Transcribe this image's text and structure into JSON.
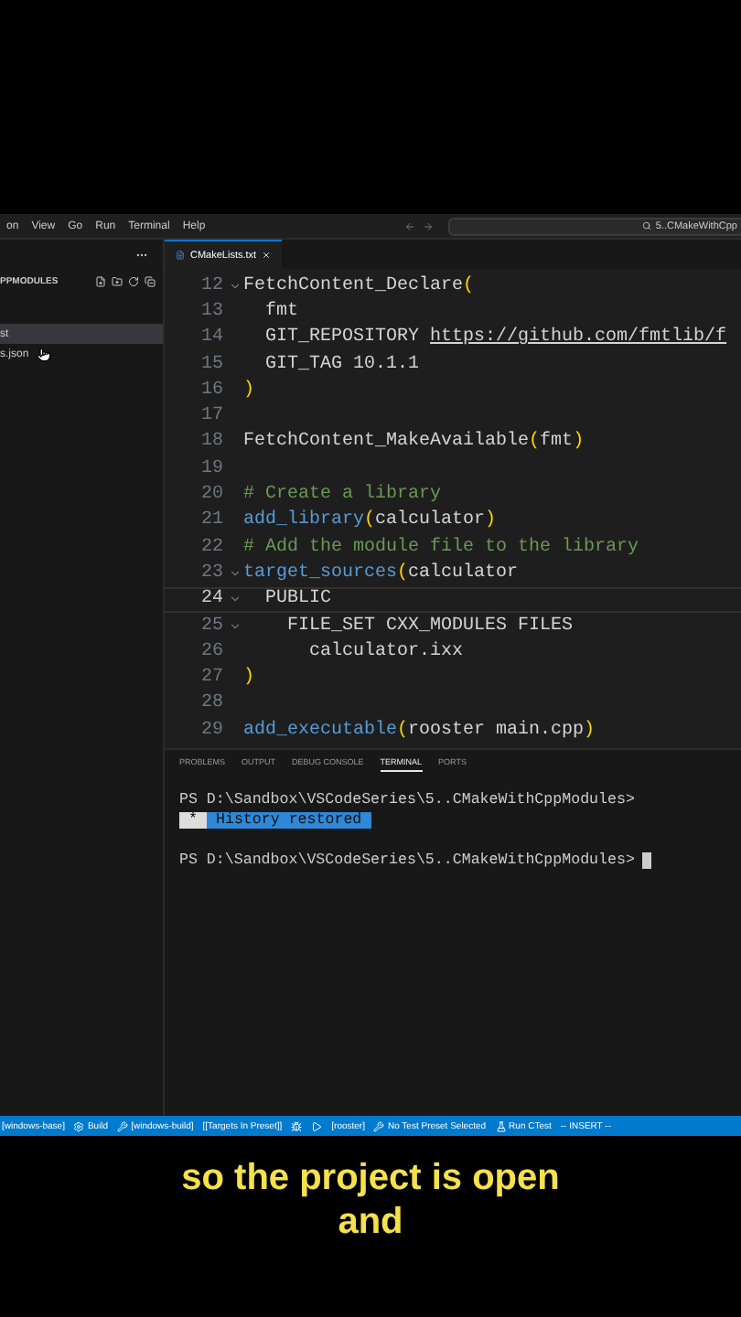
{
  "menu": [
    "on",
    "View",
    "Go",
    "Run",
    "Terminal",
    "Help"
  ],
  "search": {
    "value": "5..CMakeWithCpp"
  },
  "sidebar": {
    "title": "PPMODULES",
    "items": [
      {
        "label": "st",
        "selected": true
      },
      {
        "label": "s.json",
        "selected": false
      }
    ]
  },
  "editor_tabs": [
    {
      "label": "CMakeLists.txt",
      "selected": true
    }
  ],
  "code_lines": [
    {
      "number": "12",
      "fold": true,
      "current": false,
      "tokens": [
        {
          "kind": "plain",
          "text": "FetchContent_Declare"
        },
        {
          "kind": "paren",
          "text": "("
        }
      ]
    },
    {
      "number": "13",
      "fold": false,
      "current": false,
      "tokens": [
        {
          "kind": "plain",
          "text": "  fmt"
        }
      ]
    },
    {
      "number": "14",
      "fold": false,
      "current": false,
      "tokens": [
        {
          "kind": "plain",
          "text": "  GIT_REPOSITORY "
        },
        {
          "kind": "link",
          "text": "https://github.com/fmtlib/f"
        }
      ]
    },
    {
      "number": "15",
      "fold": false,
      "current": false,
      "tokens": [
        {
          "kind": "plain",
          "text": "  GIT_TAG 10.1.1"
        }
      ]
    },
    {
      "number": "16",
      "fold": false,
      "current": false,
      "tokens": [
        {
          "kind": "paren",
          "text": ")"
        }
      ]
    },
    {
      "number": "17",
      "fold": false,
      "current": false
    },
    {
      "number": "18",
      "fold": false,
      "current": false,
      "tokens": [
        {
          "kind": "plain",
          "text": "FetchContent_MakeAvailable"
        },
        {
          "kind": "paren",
          "text": "("
        },
        {
          "kind": "plain",
          "text": "fmt"
        },
        {
          "kind": "paren",
          "text": ")"
        }
      ]
    },
    {
      "number": "19",
      "fold": false,
      "current": false
    },
    {
      "number": "20",
      "fold": false,
      "current": false,
      "tokens": [
        {
          "kind": "comment",
          "text": "# Create a library"
        }
      ]
    },
    {
      "number": "21",
      "fold": false,
      "current": false,
      "tokens": [
        {
          "kind": "call",
          "text": "add_library"
        },
        {
          "kind": "paren",
          "text": "("
        },
        {
          "kind": "plain",
          "text": "calculator"
        },
        {
          "kind": "paren",
          "text": ")"
        }
      ]
    },
    {
      "number": "22",
      "fold": false,
      "current": false,
      "tokens": [
        {
          "kind": "comment",
          "text": "# Add the module file to the library"
        }
      ]
    },
    {
      "number": "23",
      "fold": true,
      "current": false,
      "tokens": [
        {
          "kind": "call",
          "text": "target_sources"
        },
        {
          "kind": "paren",
          "text": "("
        },
        {
          "kind": "plain",
          "text": "calculator"
        }
      ]
    },
    {
      "number": "24",
      "fold": true,
      "current": true,
      "tokens": [
        {
          "kind": "plain",
          "text": "  PUBLIC"
        }
      ]
    },
    {
      "number": "25",
      "fold": true,
      "current": false,
      "tokens": [
        {
          "kind": "plain",
          "text": "    FILE_SET CXX_MODULES FILES"
        }
      ]
    },
    {
      "number": "26",
      "fold": false,
      "current": false,
      "tokens": [
        {
          "kind": "plain",
          "text": "      calculator.ixx"
        }
      ]
    },
    {
      "number": "27",
      "fold": false,
      "current": false,
      "tokens": [
        {
          "kind": "paren",
          "text": ")"
        }
      ]
    },
    {
      "number": "28",
      "fold": false,
      "current": false
    },
    {
      "number": "29",
      "fold": false,
      "current": false,
      "tokens": [
        {
          "kind": "call",
          "text": "add_executable"
        },
        {
          "kind": "paren",
          "text": "("
        },
        {
          "kind": "plain",
          "text": "rooster main.cpp"
        },
        {
          "kind": "paren",
          "text": ")"
        }
      ]
    }
  ],
  "panel_tabs": [
    {
      "label": "PROBLEMS",
      "selected": false
    },
    {
      "label": "OUTPUT",
      "selected": false
    },
    {
      "label": "DEBUG CONSOLE",
      "selected": false
    },
    {
      "label": "TERMINAL",
      "selected": true
    },
    {
      "label": "PORTS",
      "selected": false
    }
  ],
  "terminal": {
    "lines": [
      {
        "kind": "prompt",
        "text": "PS D:\\Sandbox\\VSCodeSeries\\5..CMakeWithCppModules>"
      },
      {
        "kind": "notice",
        "marker": "*",
        "text": "History restored"
      },
      {
        "kind": "blank"
      },
      {
        "kind": "prompt",
        "text": "PS D:\\Sandbox\\VSCodeSeries\\5..CMakeWithCppModules>",
        "cursor": true
      }
    ]
  },
  "status_bar": [
    {
      "kind": "plain",
      "text": "[windows-base]"
    },
    {
      "kind": "build",
      "text": "Build"
    },
    {
      "kind": "preset",
      "text": "[windows-build]"
    },
    {
      "kind": "plain",
      "text": "[[Targets In Preset]]"
    },
    {
      "kind": "debug"
    },
    {
      "kind": "launch"
    },
    {
      "kind": "plain",
      "text": "[rooster]"
    },
    {
      "kind": "preset",
      "text": "No Test Preset Selected"
    },
    {
      "kind": "test",
      "text": "Run CTest"
    },
    {
      "kind": "plain",
      "text": "-- INSERT --"
    }
  ],
  "subtitle": [
    "so the project is open",
    "and"
  ]
}
